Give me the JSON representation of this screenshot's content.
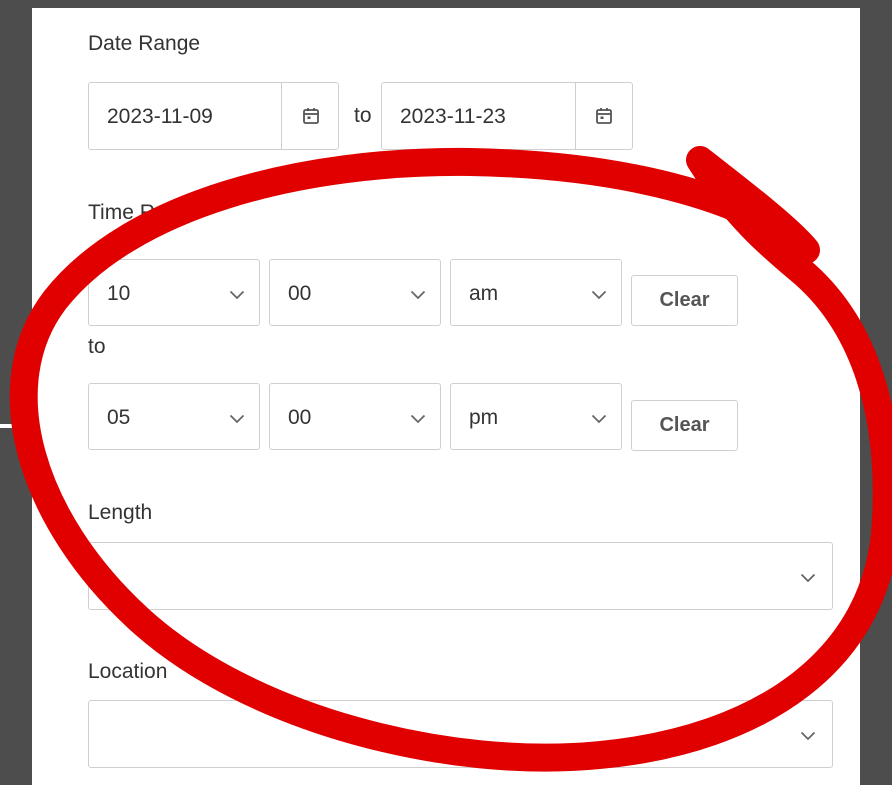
{
  "date_range": {
    "label": "Date Range",
    "start": "2023-11-09",
    "separator": "to",
    "end": "2023-11-23"
  },
  "time_range": {
    "label": "Time Range",
    "start": {
      "hour": "10",
      "minute": "00",
      "period": "am",
      "clear_label": "Clear"
    },
    "separator": "to",
    "end": {
      "hour": "05",
      "minute": "00",
      "period": "pm",
      "clear_label": "Clear"
    }
  },
  "length": {
    "label": "Length",
    "value": ""
  },
  "location": {
    "label": "Location",
    "value": ""
  },
  "icons": {
    "calendar": "calendar-icon",
    "dropdown": "chevron-down-icon"
  },
  "annotation": {
    "shape": "hand-drawn ellipse",
    "color": "#e00000"
  }
}
